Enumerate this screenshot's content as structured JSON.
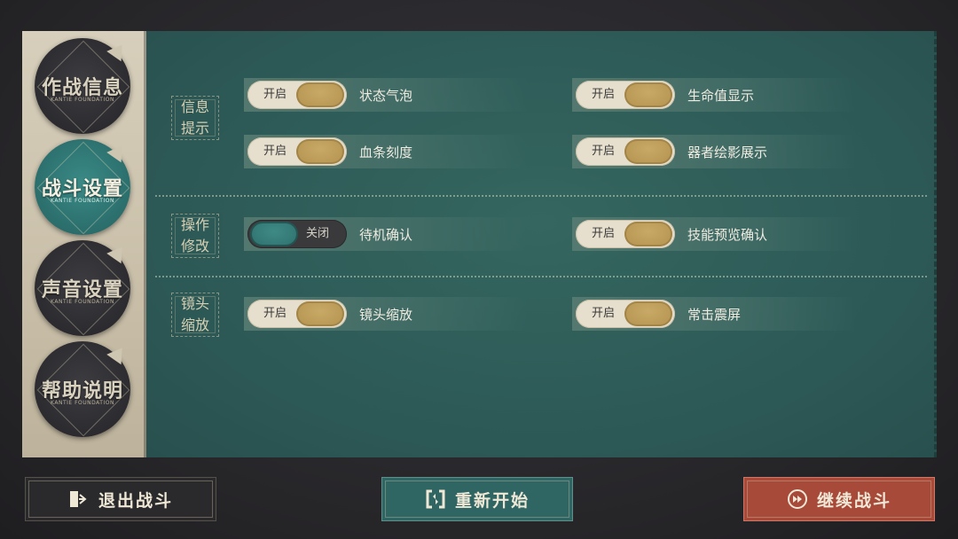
{
  "sidebar": {
    "items": [
      {
        "label": "作战信息",
        "sub": "KANTIE FOUNDATION"
      },
      {
        "label": "战斗设置",
        "sub": "KANTIE FOUNDATION"
      },
      {
        "label": "声音设置",
        "sub": "KANTIE FOUNDATION"
      },
      {
        "label": "帮助说明",
        "sub": "KANTIE FOUNDATION"
      }
    ],
    "active_index": 1
  },
  "sections": [
    {
      "label_lines": [
        "信息",
        "提示"
      ],
      "options": [
        {
          "state": "开启",
          "on": true,
          "label": "状态气泡"
        },
        {
          "state": "开启",
          "on": true,
          "label": "生命值显示"
        },
        {
          "state": "开启",
          "on": true,
          "label": "血条刻度"
        },
        {
          "state": "开启",
          "on": true,
          "label": "器者绘影展示"
        }
      ]
    },
    {
      "label_lines": [
        "操作",
        "修改"
      ],
      "options": [
        {
          "state": "关闭",
          "on": false,
          "label": "待机确认"
        },
        {
          "state": "开启",
          "on": true,
          "label": "技能预览确认"
        }
      ]
    },
    {
      "label_lines": [
        "镜头",
        "缩放"
      ],
      "options": [
        {
          "state": "开启",
          "on": true,
          "label": "镜头缩放"
        },
        {
          "state": "开启",
          "on": true,
          "label": "常击震屏"
        }
      ]
    }
  ],
  "buttons": {
    "exit": "退出战斗",
    "restart": "重新开始",
    "continue": "继续战斗"
  },
  "colors": {
    "panel": "#2e5d5a",
    "toggle_knob_on": "#b8974f",
    "toggle_knob_off": "#2e6f6c",
    "continue_button": "#a84a3a",
    "restart_button": "#2f6563"
  }
}
